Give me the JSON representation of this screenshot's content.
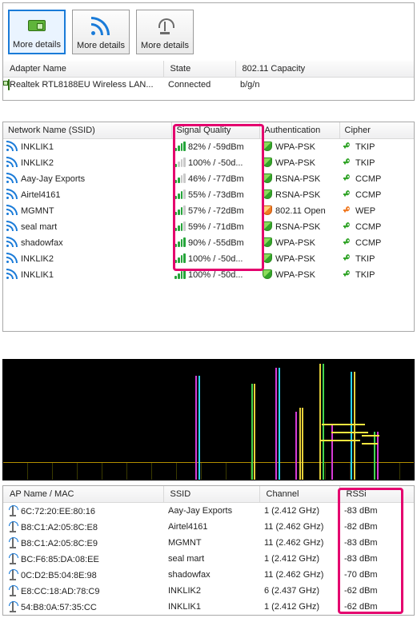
{
  "toolbar": {
    "btn1_label": "More details",
    "btn2_label": "More details",
    "btn3_label": "More details"
  },
  "adapter_headers": {
    "name": "Adapter Name",
    "state": "State",
    "capacity": "802.11 Capacity"
  },
  "adapter_row": {
    "name": "Realtek RTL8188EU Wireless LAN...",
    "state": "Connected",
    "capacity": "b/g/n"
  },
  "net_headers": {
    "ssid": "Network Name (SSID)",
    "signal": "Signal Quality",
    "auth": "Authentication",
    "cipher": "Cipher"
  },
  "networks": [
    {
      "ssid": "INKLIK1",
      "signal": "82% / -59dBm",
      "bars": 4,
      "auth": "WPA-PSK",
      "shield": "green",
      "cipher": "TKIP",
      "key": "green"
    },
    {
      "ssid": "INKLIK2",
      "signal": "100% / -50d...",
      "bars": 1,
      "auth": "WPA-PSK",
      "shield": "green",
      "cipher": "TKIP",
      "key": "green"
    },
    {
      "ssid": "Aay-Jay Exports",
      "signal": "46% / -77dBm",
      "bars": 2,
      "auth": "RSNA-PSK",
      "shield": "green",
      "cipher": "CCMP",
      "key": "green"
    },
    {
      "ssid": "Airtel4161",
      "signal": "55% / -73dBm",
      "bars": 3,
      "auth": "RSNA-PSK",
      "shield": "green",
      "cipher": "CCMP",
      "key": "green"
    },
    {
      "ssid": "MGMNT",
      "signal": "57% / -72dBm",
      "bars": 3,
      "auth": "802.11 Open",
      "shield": "orange",
      "cipher": "WEP",
      "key": "orange"
    },
    {
      "ssid": "seal mart",
      "signal": "59% / -71dBm",
      "bars": 3,
      "auth": "RSNA-PSK",
      "shield": "green",
      "cipher": "CCMP",
      "key": "green"
    },
    {
      "ssid": "shadowfax",
      "signal": "90% / -55dBm",
      "bars": 4,
      "auth": "WPA-PSK",
      "shield": "green",
      "cipher": "CCMP",
      "key": "green"
    },
    {
      "ssid": "INKLIK2",
      "signal": "100% / -50d...",
      "bars": 4,
      "auth": "WPA-PSK",
      "shield": "green",
      "cipher": "TKIP",
      "key": "green"
    },
    {
      "ssid": "INKLIK1",
      "signal": "100% / -50d...",
      "bars": 4,
      "auth": "WPA-PSK",
      "shield": "green",
      "cipher": "TKIP",
      "key": "green"
    }
  ],
  "ap_headers": {
    "name": "AP Name / MAC",
    "ssid": "SSID",
    "channel": "Channel",
    "rssi": "RSSi"
  },
  "aps": [
    {
      "mac": "6C:72:20:EE:80:16",
      "ssid": "Aay-Jay Exports",
      "channel": "1 (2.412 GHz)",
      "rssi": "-83 dBm"
    },
    {
      "mac": "B8:C1:A2:05:8C:E8",
      "ssid": "Airtel4161",
      "channel": "11 (2.462 GHz)",
      "rssi": "-82 dBm"
    },
    {
      "mac": "B8:C1:A2:05:8C:E9",
      "ssid": "MGMNT",
      "channel": "11 (2.462 GHz)",
      "rssi": "-83 dBm"
    },
    {
      "mac": "BC:F6:85:DA:08:EE",
      "ssid": "seal mart",
      "channel": "1 (2.412 GHz)",
      "rssi": "-83 dBm"
    },
    {
      "mac": "0C:D2:B5:04:8E:98",
      "ssid": "shadowfax",
      "channel": "11 (2.462 GHz)",
      "rssi": "-70 dBm"
    },
    {
      "mac": "E8:CC:18:AD:78:C9",
      "ssid": "INKLIK2",
      "channel": "6 (2.437 GHz)",
      "rssi": "-62 dBm"
    },
    {
      "mac": "54:B8:0A:57:35:CC",
      "ssid": "INKLIK1",
      "channel": "1 (2.412 GHz)",
      "rssi": "-62 dBm"
    }
  ]
}
